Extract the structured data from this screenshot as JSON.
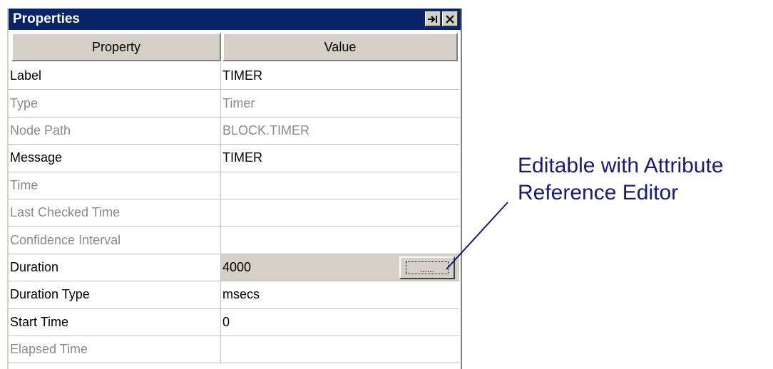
{
  "panel": {
    "title": "Properties",
    "pin_icon": "pin-icon",
    "close_icon": "close-icon"
  },
  "columns": {
    "property": "Property",
    "value": "Value"
  },
  "rows": [
    {
      "property": "Label",
      "value": "TIMER",
      "enabled": true
    },
    {
      "property": "Type",
      "value": "Timer",
      "enabled": false
    },
    {
      "property": "Node Path",
      "value": "BLOCK.TIMER",
      "enabled": false
    },
    {
      "property": "Message",
      "value": "TIMER",
      "enabled": true
    },
    {
      "property": "Time",
      "value": "",
      "enabled": false
    },
    {
      "property": "Last Checked Time",
      "value": "",
      "enabled": false
    },
    {
      "property": "Confidence Interval",
      "value": "",
      "enabled": false
    },
    {
      "property": "Duration",
      "value": "4000",
      "enabled": true,
      "button": "......"
    },
    {
      "property": "Duration Type",
      "value": "msecs",
      "enabled": true
    },
    {
      "property": "Start Time",
      "value": "0",
      "enabled": true
    },
    {
      "property": "Elapsed Time",
      "value": "",
      "enabled": false
    }
  ],
  "annotation": {
    "line1": "Editable with Attribute",
    "line2": "Reference Editor",
    "color": "#1a1a6e"
  },
  "colors": {
    "titlebar": "#0a246a",
    "disabled_text": "#8a8a8a",
    "button_face": "#d4d0c8"
  }
}
